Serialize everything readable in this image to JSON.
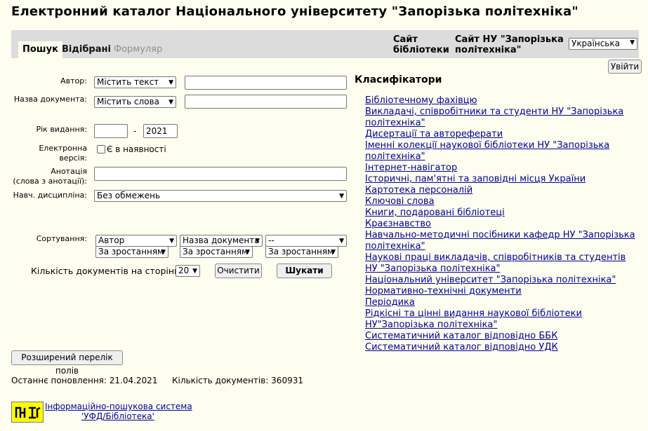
{
  "header": {
    "title": "Електронний каталог Національного університету \"Запорізька політехніка\""
  },
  "tabs": {
    "search": "Пошук",
    "favorites": "Відібрані",
    "form": "Формуляр"
  },
  "toplinks": {
    "library_site_1": "Сайт",
    "library_site_2": "бібліотеки",
    "university_site_1": "Сайт НУ \"Запорізька",
    "university_site_2": "політехніка\""
  },
  "language": {
    "selected": "Українська"
  },
  "login_button": "Увійти",
  "form": {
    "author_label": "Автор:",
    "author_mode": "Містить текст",
    "doc_title_label": "Назва документа:",
    "doc_title_mode": "Містить слова",
    "year_label": "Рік видання:",
    "year_from": "",
    "year_sep": "-",
    "year_to": "2021",
    "electronic_label_1": "Електронна",
    "electronic_label_2": "версія:",
    "electronic_checkbox": "Є в наявності",
    "annotation_label_1": "Анотація",
    "annotation_label_2": "(слова з анотації):",
    "discipline_label": "Навч. дисципліна:",
    "discipline_value": "Без обмежень",
    "sort_label": "Сортування:",
    "sort1": "Автор",
    "sort2": "Назва документа",
    "sort3": "--",
    "order1": "За зростанням",
    "order2": "За зростанням",
    "order3": "За зростанням",
    "per_page_label": "Кількість документів на сторінці",
    "per_page_value": "20",
    "clear_button": "Очистити",
    "search_button": "Шукати",
    "extended_button": "Розширений перелік полів"
  },
  "classifiers": {
    "title": "Класифікатори",
    "items": [
      "Бібліотечному фахівцю",
      "Викладачі, співробітники та студенти НУ \"Запорізька політехніка\"",
      "Дисертації та автореферати",
      "Іменні колекції наукової бібліотеки НУ \"Запорізька політехніка\"",
      "Інтернет-навігатор",
      "Історичні, пам'ятні та заповідні місця України",
      "Картотека персоналій",
      "Ключові слова",
      "Книги, подаровані бібліотеці",
      "Краєзнавство",
      "Навчально-методичні посібники кафедр НУ \"Запорізька політехніка\"",
      "Наукові праці викладачів, співробітників та студентів НУ \"Запорізька політехніка\"",
      "Національний університет \"Запорізька політехніка\"",
      "Нормативно-технічні документи",
      "Періодика",
      "Рідкісні та цінні видання наукової бібліотеки НУ\"Запорізька політехніка\"",
      "Систематичний каталог відповідно ББК",
      "Систематичний каталог відповідно УДК"
    ]
  },
  "footer": {
    "updated": "Останнє поновлення: 21.04.2021",
    "count": "Кількість документів: 360931",
    "system_line1": "Інформаційно-пошукова система",
    "system_line2": "'УФД/Бібліотека'"
  }
}
